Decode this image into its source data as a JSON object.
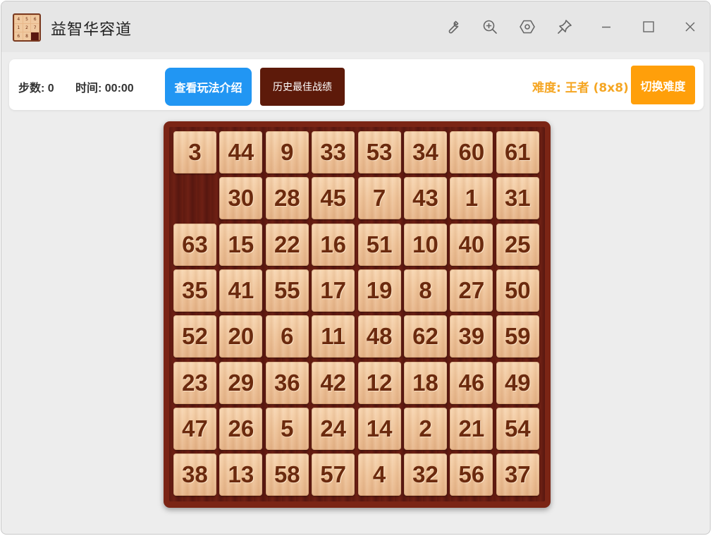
{
  "window": {
    "title": "益智华容道"
  },
  "app_icon": {
    "cells": [
      "4",
      "5",
      "6",
      "1",
      "2",
      "7",
      "6",
      "8",
      ""
    ]
  },
  "titlebar_icons": [
    "wrench-icon",
    "zoom-in-icon",
    "hexagon-settings-icon",
    "pin-icon",
    "minimize-icon",
    "maximize-icon",
    "close-icon"
  ],
  "stats": {
    "steps": "步数: 0",
    "time": "时间: 00:00"
  },
  "buttons": {
    "help": "查看玩法介绍",
    "history": "历史最佳战绩",
    "switch": "切换难度"
  },
  "difficulty": "难度: 王者 (8x8)",
  "colors": {
    "help_button": "#2196f3",
    "history_button": "#5d1a0a",
    "switch_button": "#ff9f0a",
    "difficulty_text": "#f5a623",
    "board_frame": "#7b2515",
    "tile_text": "#6b2a0e"
  },
  "board": {
    "size": 8,
    "grid": [
      [
        3,
        44,
        9,
        33,
        53,
        34,
        60,
        61
      ],
      [
        null,
        30,
        28,
        45,
        7,
        43,
        1,
        31
      ],
      [
        63,
        15,
        22,
        16,
        51,
        10,
        40,
        25
      ],
      [
        35,
        41,
        55,
        17,
        19,
        8,
        27,
        50
      ],
      [
        52,
        20,
        6,
        11,
        48,
        62,
        39,
        59
      ],
      [
        23,
        29,
        36,
        42,
        12,
        18,
        46,
        49
      ],
      [
        47,
        26,
        5,
        24,
        14,
        2,
        21,
        54
      ],
      [
        38,
        13,
        58,
        57,
        4,
        32,
        56,
        37
      ]
    ]
  }
}
